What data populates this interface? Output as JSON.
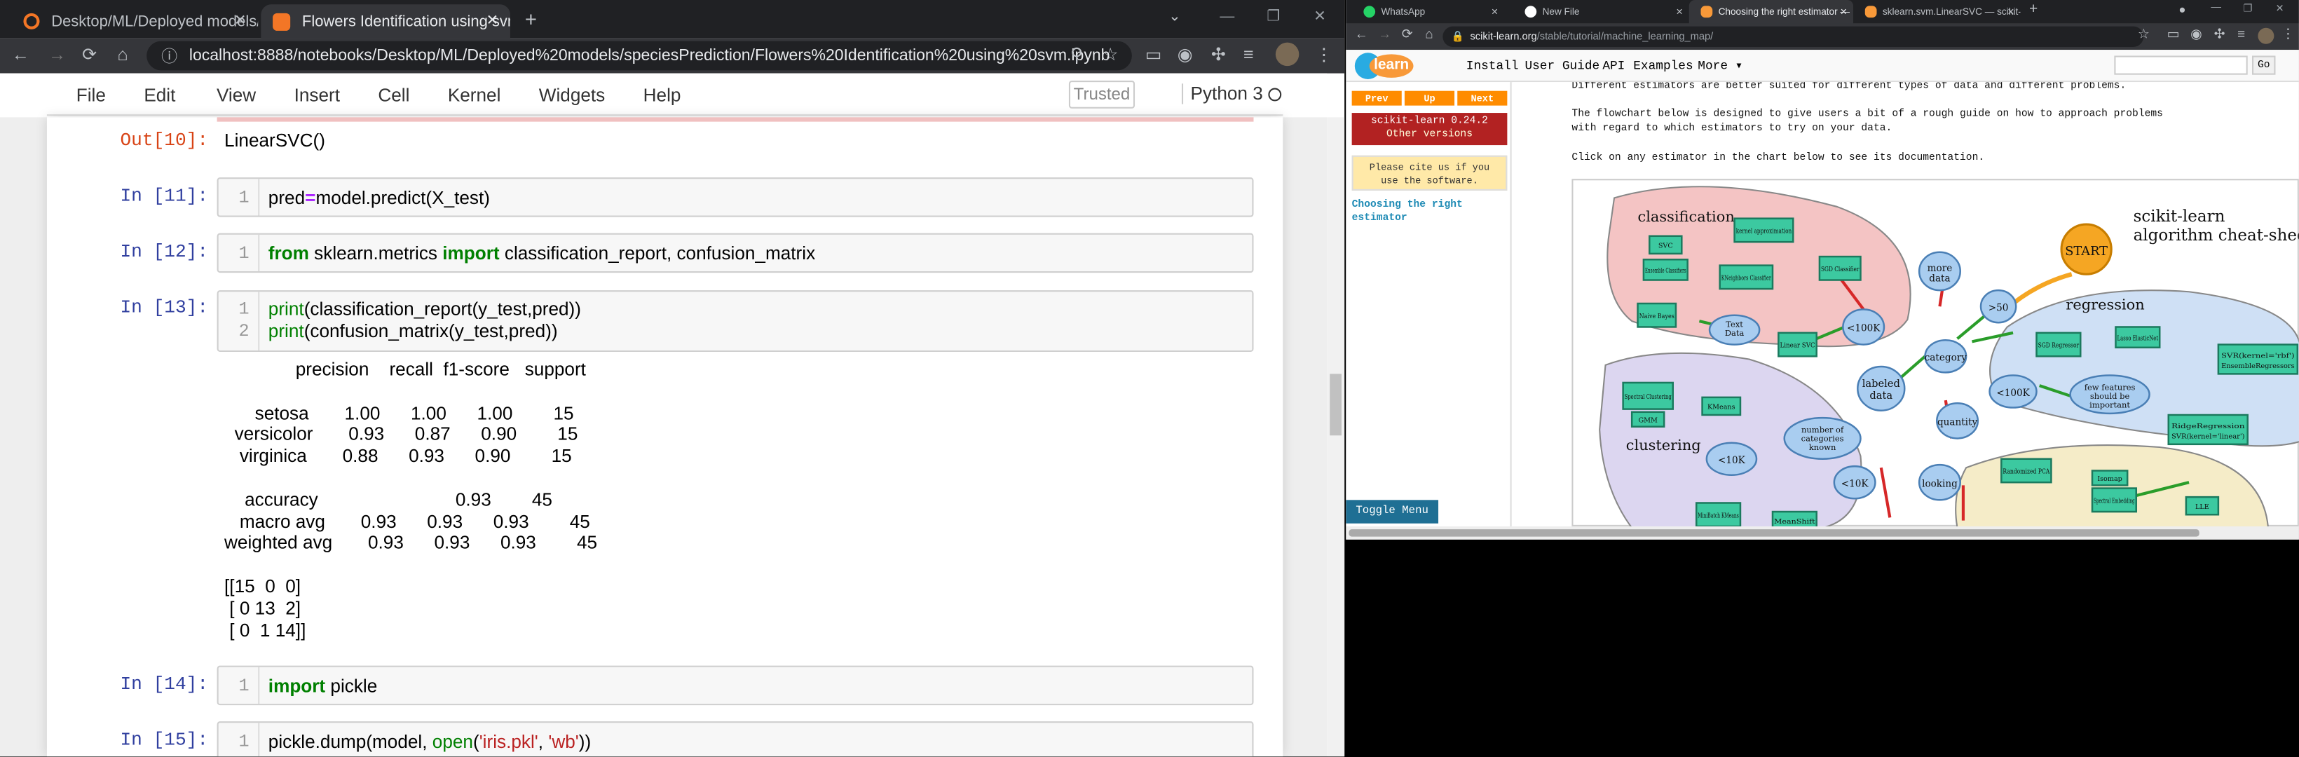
{
  "left_window": {
    "tabs": [
      {
        "title": "Desktop/ML/Deployed models/s"
      },
      {
        "title": "Flowers Identification using svm"
      }
    ],
    "new_tab_symbol": "+",
    "url": "localhost:8888/notebooks/Desktop/ML/Deployed%20models/speciesPrediction/Flowers%20Identification%20using%20svm.ipynb",
    "menu": [
      "File",
      "Edit",
      "View",
      "Insert",
      "Cell",
      "Kernel",
      "Widgets",
      "Help"
    ],
    "trusted_label": "Trusted",
    "kernel_label": "Python 3",
    "cells": {
      "out10_prompt": "Out[10]:",
      "out10_text": "LinearSVC()",
      "in11_prompt": "In [11]:",
      "in11_line": "1",
      "in12_prompt": "In [12]:",
      "in12_line": "1",
      "in13_prompt": "In [13]:",
      "in13_line1": "1",
      "in13_line2": "2",
      "in14_prompt": "In [14]:",
      "in14_line": "1",
      "in15_prompt": "In [15]:",
      "in15_line": "1"
    },
    "code": {
      "c11_pred": "pred",
      "c11_eq": "=",
      "c11_rest": "model.predict(X_test)",
      "c12_from": "from",
      "c12_mid": " sklearn.metrics ",
      "c12_import": "import",
      "c12_rest": " classification_report, confusion_matrix",
      "c13_print1": "print",
      "c13_rest1": "(classification_report(y_test,pred))",
      "c13_print2": "print",
      "c13_rest2": "(confusion_matrix(y_test,pred))",
      "c14_import": "import",
      "c14_rest": " pickle",
      "c15_a": "pickle.dump(model, ",
      "c15_open": "open",
      "c15_b": "(",
      "c15_s1": "'iris.pkl'",
      "c15_c": ", ",
      "c15_s2": "'wb'",
      "c15_d": "))"
    },
    "report": {
      "header": "              precision    recall  f1-score   support",
      "rows": [
        "      setosa       1.00      1.00      1.00        15",
        "  versicolor       0.93      0.87      0.90        15",
        "   virginica       0.88      0.93      0.90        15",
        "",
        "    accuracy                           0.93        45",
        "   macro avg       0.93      0.93      0.93        45",
        "weighted avg       0.93      0.93      0.93        45",
        "",
        "[[15  0  0]",
        " [ 0 13  2]",
        " [ 0  1 14]]"
      ]
    }
  },
  "right_window": {
    "tabs": [
      {
        "title": "WhatsApp"
      },
      {
        "title": "New File"
      },
      {
        "title": "Choosing the right estimator —"
      },
      {
        "title": "sklearn.svm.LinearSVC — scikit-le"
      }
    ],
    "url_domain": "scikit-learn.org",
    "url_path": "/stable/tutorial/machine_learning_map/",
    "nav": [
      "Install",
      "User Guide",
      "API",
      "Examples",
      "More"
    ],
    "go_label": "Go",
    "prev_label": "Prev",
    "up_label": "Up",
    "next_label": "Next",
    "version_line1": "scikit-learn 0.24.2",
    "version_line2": "Other versions",
    "cite_line1": "Please cite us if you",
    "cite_line2": "use the software.",
    "toc_line1": "Choosing the right",
    "toc_line2": "estimator",
    "toggle_label": "Toggle Menu",
    "paragraph1": "Different estimators are better suited for different types of data and different problems.",
    "paragraph2a": "The flowchart below is designed to give users a bit of a rough guide on how to approach problems",
    "paragraph2b": "with regard to which estimators to try on your data.",
    "paragraph3": "Click on any estimator in the chart below to see its documentation.",
    "map": {
      "title1": "scikit-learn",
      "title2": "algorithm cheat-sheet",
      "start": "START",
      "classification": "classification",
      "regression": "regression",
      "clustering": "clustering",
      "labeled_data_1": "labeled",
      "labeled_data_2": "data",
      "more_data_1": "more",
      "more_data_2": "data",
      "gt50": ">50",
      "lt100k": "<100K",
      "lt10k": "<10K",
      "category": "category",
      "quantity": "quantity",
      "looking": "looking",
      "number_of_cat_1": "number of",
      "number_of_cat_2": "categories",
      "number_of_cat_3": "known",
      "few_features_1": "few features",
      "few_features_2": "should be",
      "few_features_3": "important",
      "text_data_1": "Text",
      "text_data_2": "Data",
      "boxes": {
        "svc": "SVC",
        "ensemble_cls": "Ensemble Classifiers",
        "kernel_approx": "kernel approximation",
        "kneighbors": "KNeighbors Classifier",
        "sgd_cls": "SGD Classifier",
        "naive_bayes": "Naive Bayes",
        "linear_svc": "Linear SVC",
        "spectral": "Spectral Clustering",
        "gmm": "GMM",
        "kmeans": "KMeans",
        "minibatch": "MiniBatch KMeans",
        "meanshift": "MeanShift",
        "sgd_reg": "SGD Regressor",
        "lasso": "Lasso ElasticNet",
        "svr": "SVR(kernel='rbf')",
        "ensemble_reg": "EnsembleRegressors",
        "ridge": "RidgeRegression",
        "svr_lin": "SVR(kernel='linear')",
        "randomized_pca": "Randomized PCA",
        "isomap": "Isomap",
        "spectral_emb": "Spectral Embedding",
        "lle": "LLE"
      }
    }
  }
}
